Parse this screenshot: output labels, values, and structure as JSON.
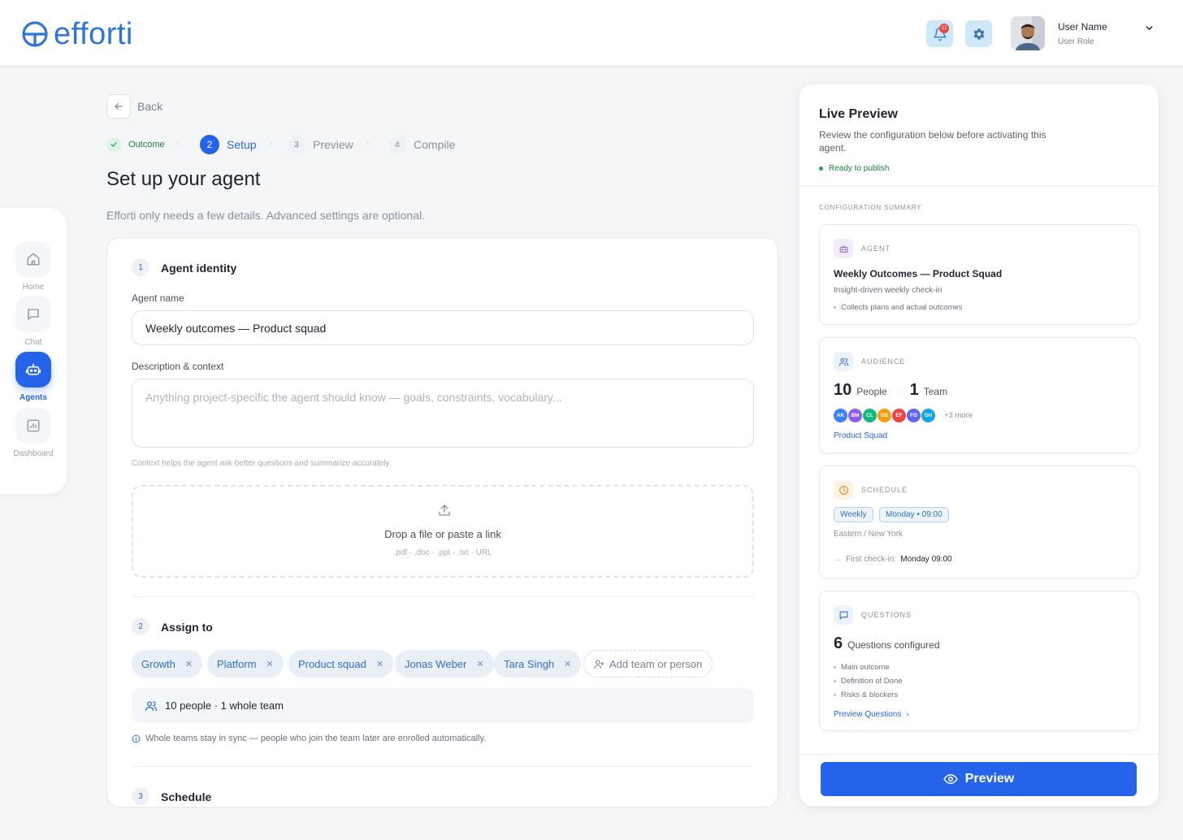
{
  "header": {
    "logo_text": "efforti",
    "notification_count": "11",
    "user_name": "User Name",
    "user_role": "User Role"
  },
  "sidebar": {
    "items": [
      {
        "label": "Home",
        "icon": "home-icon"
      },
      {
        "label": "Chat",
        "icon": "chat-icon"
      },
      {
        "label": "Agents",
        "icon": "robot-icon",
        "active": true
      },
      {
        "label": "Dashboard",
        "icon": "chart-icon"
      }
    ]
  },
  "back_label": "Back",
  "steps": [
    {
      "num": "",
      "label": "Outcome",
      "state": "done"
    },
    {
      "num": "2",
      "label": "Setup",
      "state": "active"
    },
    {
      "num": "3",
      "label": "Preview",
      "state": "todo"
    },
    {
      "num": "4",
      "label": "Compile",
      "state": "todo"
    }
  ],
  "page": {
    "title": "Set up your agent",
    "subtitle": "Efforti only needs a few details. Advanced settings are optional."
  },
  "identity": {
    "num": "1",
    "title": "Agent identity",
    "name_label": "Agent name",
    "name_value": "Weekly outcomes — Product squad",
    "desc_label": "Description & context",
    "desc_placeholder": "Anything project-specific the agent should know — goals, constraints, vocabulary...",
    "desc_hint": "Context helps the agent ask better questions and summarize accurately.",
    "drop_main": "Drop a file or paste a link",
    "drop_sub": ".pdf · .doc · .ppt · .txt · URL"
  },
  "assign": {
    "num": "2",
    "title": "Assign to",
    "chips": [
      "Growth",
      "Platform",
      "Product squad",
      "Jonas Weber",
      "Tara Singh"
    ],
    "add_label": "Add team or person",
    "summary": "10 people · 1 whole team",
    "info": "Whole teams stay in sync — people who join the team later are enrolled automatically."
  },
  "schedule_section": {
    "num": "3",
    "title": "Schedule"
  },
  "preview": {
    "title": "Live Preview",
    "desc": "Review the configuration below before activating this agent.",
    "status": "Ready to publish",
    "section_label": "CONFIGURATION SUMMARY",
    "agent": {
      "label": "AGENT",
      "name": "Weekly Outcomes — Product Squad",
      "tagline": "Insight-driven weekly check-in",
      "bullet": "Collects plans and actual outcomes"
    },
    "audience": {
      "label": "AUDIENCE",
      "people_num": "10",
      "people_label": "People",
      "team_num": "1",
      "team_label": "Team",
      "avatars": [
        {
          "initials": "AK",
          "color": "#3b82f6"
        },
        {
          "initials": "BM",
          "color": "#8b5cf6"
        },
        {
          "initials": "CL",
          "color": "#10b981"
        },
        {
          "initials": "DS",
          "color": "#f59e0b"
        },
        {
          "initials": "EF",
          "color": "#ef4444"
        },
        {
          "initials": "FG",
          "color": "#6366f1"
        },
        {
          "initials": "GH",
          "color": "#0ea5e9"
        }
      ],
      "more": "+3 more",
      "team_link": "Product Squad"
    },
    "schedule": {
      "label": "SCHEDULE",
      "pill_1": "Weekly",
      "pill_2": "Monday • 09:00",
      "timezone": "Eastern / New York",
      "first_label": "First check-in:",
      "first_value": "Monday 09:00"
    },
    "questions": {
      "label": "QUESTIONS",
      "count": "6",
      "count_label": "Questions configured",
      "items": [
        "Main outcome",
        "Definition of Done",
        "Risks & blockers"
      ],
      "link": "Preview Questions"
    },
    "button_label": "Preview"
  },
  "colors": {
    "accent": "#2563eb",
    "logo": "#2f74d8",
    "success": "#22a55a"
  }
}
